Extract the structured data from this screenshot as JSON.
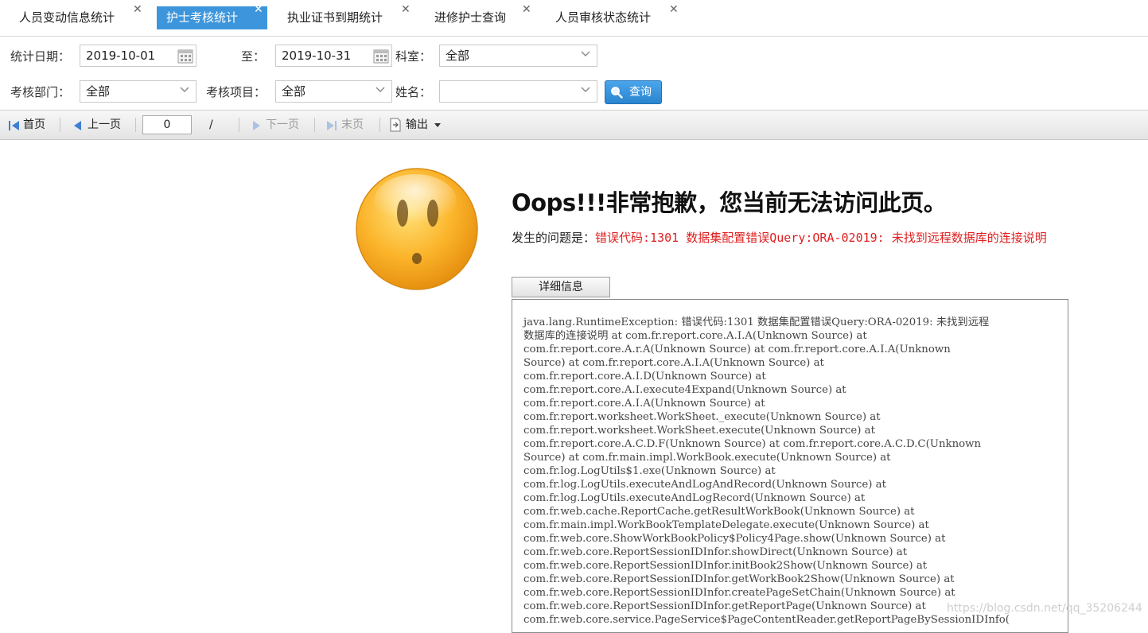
{
  "tabs": [
    {
      "label": "人员变动信息统计",
      "active": false
    },
    {
      "label": "护士考核统计",
      "active": true
    },
    {
      "label": "执业证书到期统计",
      "active": false
    },
    {
      "label": "进修护士查询",
      "active": false
    },
    {
      "label": "人员审核状态统计",
      "active": false
    }
  ],
  "tab_close_glyph": "✕",
  "filters": {
    "date_label": "统计日期：",
    "date_start": "2019-10-01",
    "to_label": "至：",
    "date_end": "2019-10-31",
    "dept_label": "科室：",
    "dept_value": "全部",
    "review_dept_label": "考核部门：",
    "review_dept_value": "全部",
    "review_item_label": "考核项目：",
    "review_item_value": "全部",
    "name_label": "姓名：",
    "name_value": "",
    "query_button": "查询"
  },
  "pager": {
    "first": "首页",
    "prev": "上一页",
    "page_value": "0",
    "slash": "/",
    "next": "下一页",
    "last": "末页",
    "export": "输出"
  },
  "error": {
    "title": "Oops!!!非常抱歉，您当前无法访问此页。",
    "problem_lead": "发生的问题是：",
    "problem_message": "错误代码:1301 数据集配置错误Query:ORA-02019: 未找到远程数据库的连接说明",
    "detail_button": "详细信息",
    "stacktrace": [
      "java.lang.RuntimeException: 错误代码:1301 数据集配置错误Query:ORA-02019: 未找到远程",
      "数据库的连接说明 at com.fr.report.core.A.I.A(Unknown Source) at",
      "com.fr.report.core.A.r.A(Unknown Source) at com.fr.report.core.A.I.A(Unknown",
      "Source) at com.fr.report.core.A.I.A(Unknown Source) at",
      "com.fr.report.core.A.I.D(Unknown Source) at",
      "com.fr.report.core.A.I.execute4Expand(Unknown Source) at",
      "com.fr.report.core.A.I.A(Unknown Source) at",
      "com.fr.report.worksheet.WorkSheet._execute(Unknown Source) at",
      "com.fr.report.worksheet.WorkSheet.execute(Unknown Source) at",
      "com.fr.report.core.A.C.D.F(Unknown Source) at com.fr.report.core.A.C.D.C(Unknown",
      "Source) at com.fr.main.impl.WorkBook.execute(Unknown Source) at",
      "com.fr.log.LogUtils$1.exe(Unknown Source) at",
      "com.fr.log.LogUtils.executeAndLogAndRecord(Unknown Source) at",
      "com.fr.log.LogUtils.executeAndLogRecord(Unknown Source) at",
      "com.fr.web.cache.ReportCache.getResultWorkBook(Unknown Source) at",
      "com.fr.main.impl.WorkBookTemplateDelegate.execute(Unknown Source) at",
      "com.fr.web.core.ShowWorkBookPolicy$Policy4Page.show(Unknown Source) at",
      "com.fr.web.core.ReportSessionIDInfor.showDirect(Unknown Source) at",
      "com.fr.web.core.ReportSessionIDInfor.initBook2Show(Unknown Source) at",
      "com.fr.web.core.ReportSessionIDInfor.getWorkBook2Show(Unknown Source) at",
      "com.fr.web.core.ReportSessionIDInfor.createPageSetChain(Unknown Source) at",
      "com.fr.web.core.ReportSessionIDInfor.getReportPage(Unknown Source) at",
      "com.fr.web.core.service.PageService$PageContentReader.getReportPageBySessionIDInfo("
    ]
  },
  "watermark": "https://blog.csdn.net/qq_35206244",
  "colors": {
    "accent": "#3d96dc",
    "error_red": "#e02020"
  }
}
